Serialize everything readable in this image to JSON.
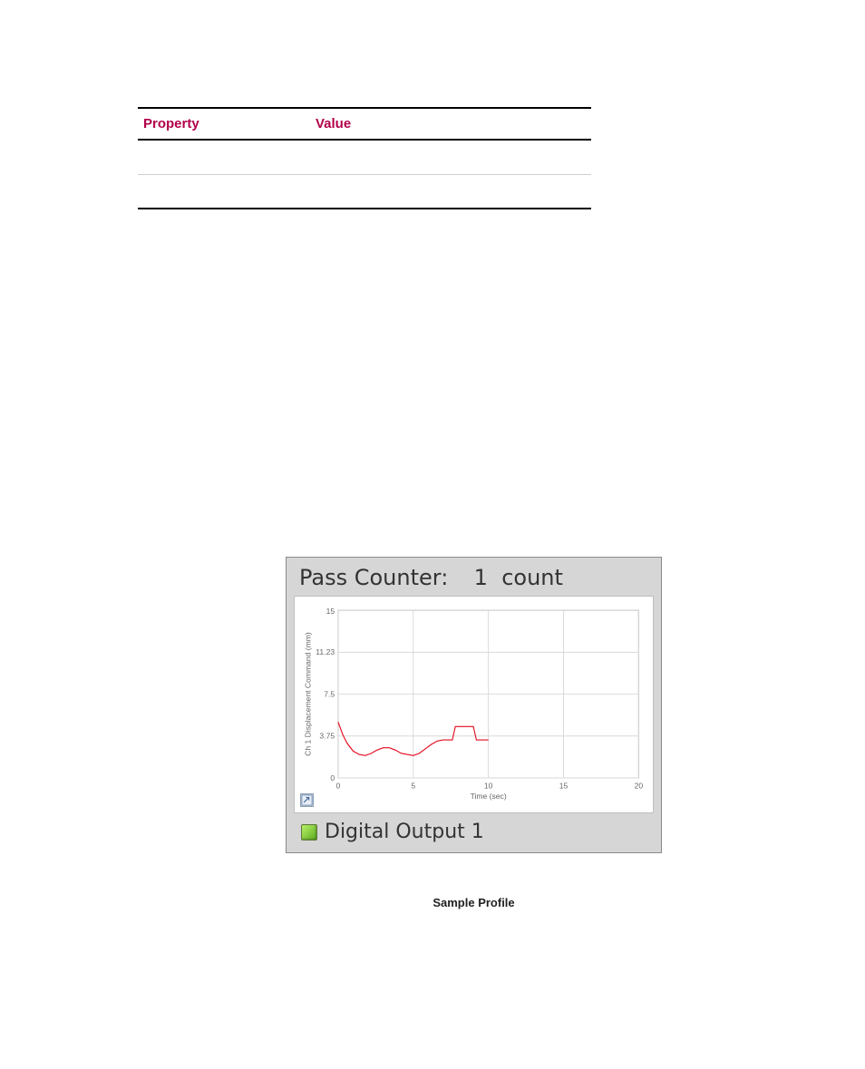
{
  "table": {
    "headers": {
      "property": "Property",
      "value": "Value"
    },
    "rows": [
      {
        "property": "",
        "value": ""
      },
      {
        "property": "",
        "value": ""
      }
    ]
  },
  "panel": {
    "header_label": "Pass Counter:",
    "header_value": "1",
    "header_unit": "count",
    "footer_label": "Digital Output 1"
  },
  "caption": "Sample Profile",
  "chart_data": {
    "type": "line",
    "title": "",
    "xlabel": "Time (sec)",
    "ylabel": "Ch 1 Displacement Command (mm)",
    "xlim": [
      0,
      20
    ],
    "ylim": [
      0,
      15
    ],
    "xticks": [
      0,
      5,
      10,
      15,
      20
    ],
    "yticks": [
      0,
      3.75,
      7.5,
      11.23,
      15
    ],
    "series": [
      {
        "name": "Ch 1 Displacement Command",
        "color": "#e30b1f",
        "x": [
          0.0,
          0.3,
          0.6,
          1.0,
          1.4,
          1.8,
          2.2,
          2.6,
          3.0,
          3.4,
          3.8,
          4.2,
          4.6,
          5.0,
          5.4,
          5.8,
          6.2,
          6.6,
          7.0,
          7.4,
          7.6,
          7.8,
          8.0,
          8.2,
          8.4,
          8.8,
          9.0,
          9.2,
          9.6,
          10.0
        ],
        "y": [
          5.0,
          3.9,
          3.1,
          2.4,
          2.1,
          2.0,
          2.2,
          2.5,
          2.7,
          2.7,
          2.5,
          2.2,
          2.1,
          2.0,
          2.2,
          2.6,
          3.0,
          3.3,
          3.4,
          3.4,
          3.4,
          4.6,
          4.6,
          4.6,
          4.6,
          4.6,
          4.6,
          3.4,
          3.4,
          3.4
        ]
      }
    ]
  }
}
